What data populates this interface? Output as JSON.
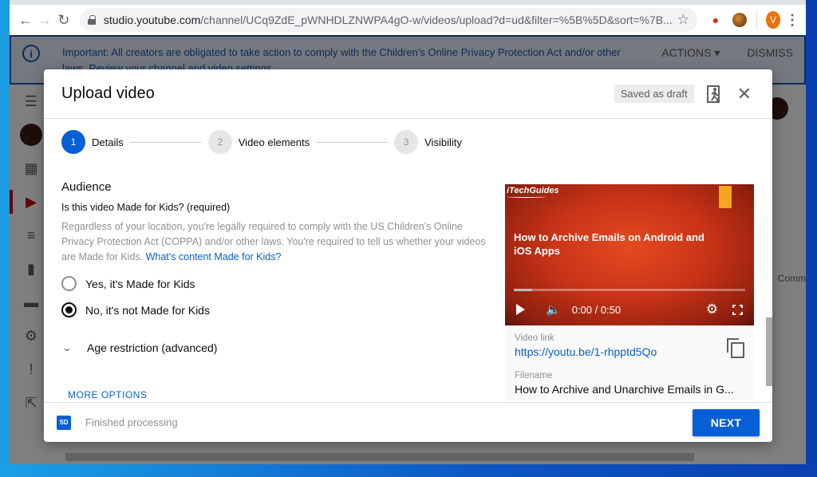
{
  "browser": {
    "url_host": "studio.youtube.com",
    "url_path": "/channel/UCq9ZdE_pWNHDLZNWPA4gO-w/videos/upload?d=ud&filter=%5B%5D&sort=%7B...",
    "profile_initial": "V",
    "icons": {
      "back": "←",
      "forward": "→",
      "reload": "↻",
      "star": "☆",
      "menu": "⋮"
    }
  },
  "banner": {
    "text": "Important: All creators are obligated to take action to comply with the Children's Online Privacy Protection Act and/or other laws. Review your channel and video settings.",
    "actions_label": "ACTIONS ▾",
    "dismiss_label": "DISMISS",
    "info_glyph": "i"
  },
  "background_page": {
    "right_column_text": "Comm"
  },
  "dialog": {
    "title": "Upload video",
    "saved_chip": "Saved as draft",
    "close_glyph": "✕",
    "steps": [
      {
        "number": "1",
        "label": "Details",
        "active": true
      },
      {
        "number": "2",
        "label": "Video elements",
        "active": false
      },
      {
        "number": "3",
        "label": "Visibility",
        "active": false
      }
    ],
    "audience": {
      "section_title": "Audience",
      "question": "Is this video Made for Kids? (required)",
      "description": "Regardless of your location, you're legally required to comply with the US Children's Online Privacy Protection Act (COPPA) and/or other laws. You're required to tell us whether your videos are Made for Kids. ",
      "help_link": "What's content Made for Kids?",
      "options": [
        {
          "label": "Yes, it's Made for Kids",
          "checked": false
        },
        {
          "label": "No, it's not Made for Kids",
          "checked": true
        }
      ],
      "age_restriction_label": "Age restriction (advanced)",
      "more_options_label": "MORE OPTIONS"
    },
    "preview": {
      "brand": "iTechGuides",
      "video_title": "How to Archive Emails on Android and iOS Apps",
      "time": "0:00 / 0:50",
      "progress_fraction": 0.08,
      "video_link_label": "Video link",
      "video_link": "https://youtu.be/1-rhpptd5Qo",
      "filename_label": "Filename",
      "filename": "How to Archive and Unarchive Emails in G..."
    },
    "footer": {
      "badge": "SD",
      "status": "Finished processing",
      "next_label": "NEXT"
    }
  },
  "colors": {
    "accent": "#065fd4",
    "banner_text": "#1a56b0",
    "youtube_red": "#cc0000"
  }
}
